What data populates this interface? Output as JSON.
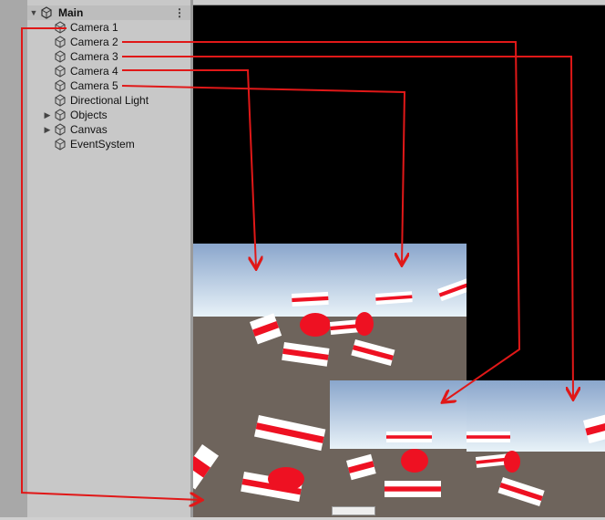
{
  "hierarchy": {
    "scene_name": "Main",
    "items": [
      {
        "label": "Camera 1",
        "icon": "cube-icon",
        "expandable": false
      },
      {
        "label": "Camera 2",
        "icon": "cube-icon",
        "expandable": false
      },
      {
        "label": "Camera 3",
        "icon": "cube-icon",
        "expandable": false
      },
      {
        "label": "Camera 4",
        "icon": "cube-icon",
        "expandable": false
      },
      {
        "label": "Camera 5",
        "icon": "cube-icon",
        "expandable": false
      },
      {
        "label": "Directional Light",
        "icon": "cube-icon",
        "expandable": false
      },
      {
        "label": "Objects",
        "icon": "cube-icon",
        "expandable": true
      },
      {
        "label": "Canvas",
        "icon": "cube-icon",
        "expandable": true
      },
      {
        "label": "EventSystem",
        "icon": "cube-icon",
        "expandable": false
      }
    ]
  },
  "game_view": {
    "button_label": "",
    "annotation_color": "#e01818"
  },
  "colors": {
    "sky_top": "#8aa6cc",
    "sky_horizon": "#e8f2f8",
    "ground": "#6e645c",
    "object_red": "#ee1122",
    "object_white": "#ffffff",
    "hierarchy_bg": "#c8c8c8"
  }
}
